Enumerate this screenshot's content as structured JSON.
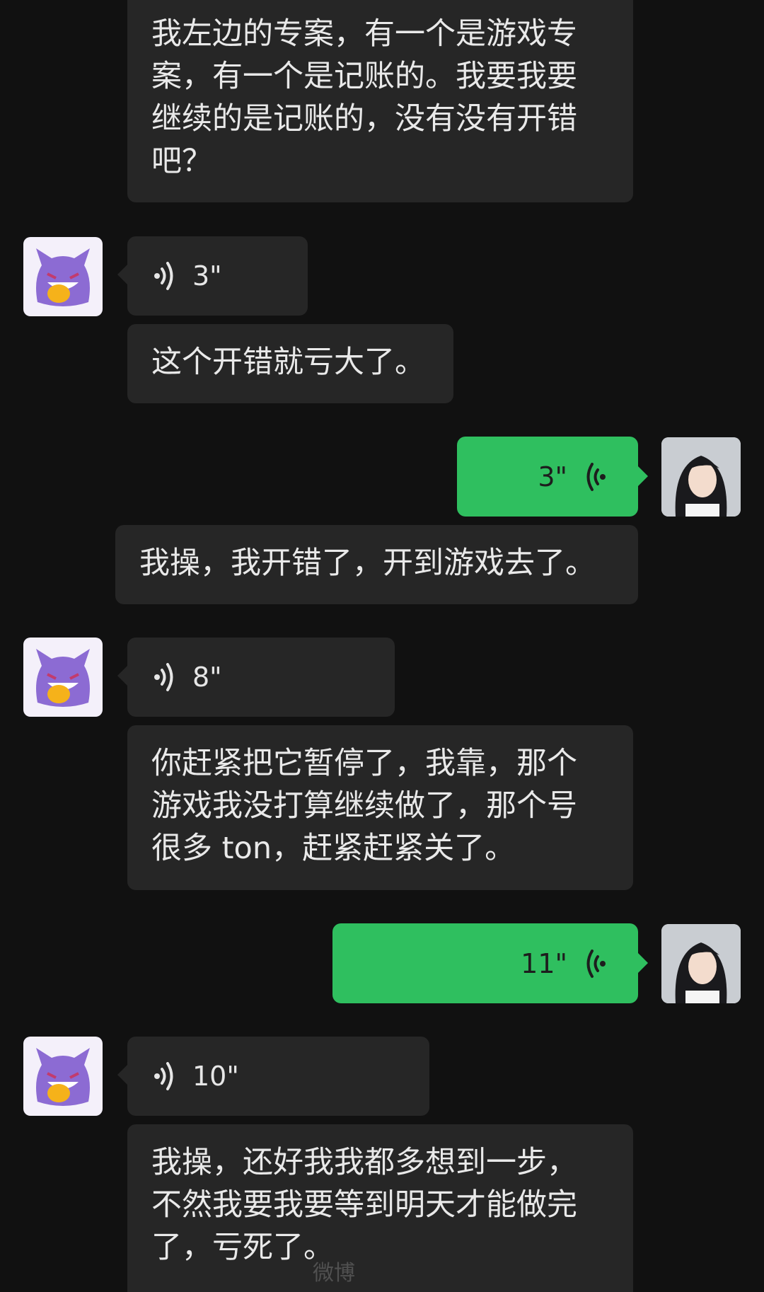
{
  "messages": [
    {
      "id": "m1",
      "side": "left",
      "kind": "text",
      "text_lines": [
        "我左边的专案，有一个是游戏专",
        "案，有一个是记账的。我要我要",
        "继续的是记账的，没有没有开错",
        "吧？"
      ]
    },
    {
      "id": "m2",
      "side": "left",
      "kind": "voice",
      "duration": "3\""
    },
    {
      "id": "m3",
      "side": "left",
      "kind": "text",
      "text_lines": [
        "这个开错就亏大了。"
      ]
    },
    {
      "id": "m4",
      "side": "right",
      "kind": "voice",
      "duration": "3\""
    },
    {
      "id": "m5",
      "side": "right",
      "kind": "text",
      "text_lines": [
        "我操，我开错了，开到游戏去了。"
      ]
    },
    {
      "id": "m6",
      "side": "left",
      "kind": "voice",
      "duration": "8\""
    },
    {
      "id": "m7",
      "side": "left",
      "kind": "text",
      "text_lines": [
        "你赶紧把它暂停了，我靠，那个",
        "游戏我没打算继续做了，那个号",
        "很多 ton，赶紧赶紧关了。"
      ]
    },
    {
      "id": "m8",
      "side": "right",
      "kind": "voice",
      "duration": "11\""
    },
    {
      "id": "m9",
      "side": "left",
      "kind": "voice",
      "duration": "10\""
    },
    {
      "id": "m10",
      "side": "left",
      "kind": "text",
      "text_lines": [
        "我操，还好我我都多想到一步，",
        "不然我要我要等到明天才能做完",
        "了，亏死了。"
      ]
    }
  ],
  "avatars": {
    "contact": "purple-ghost-avatar",
    "me": "girl-photo-avatar"
  },
  "colors": {
    "background": "#111111",
    "incoming_bubble": "#262626",
    "outgoing_bubble": "#2fbf5f",
    "incoming_text": "#e9e9e9"
  },
  "watermark": "微博"
}
